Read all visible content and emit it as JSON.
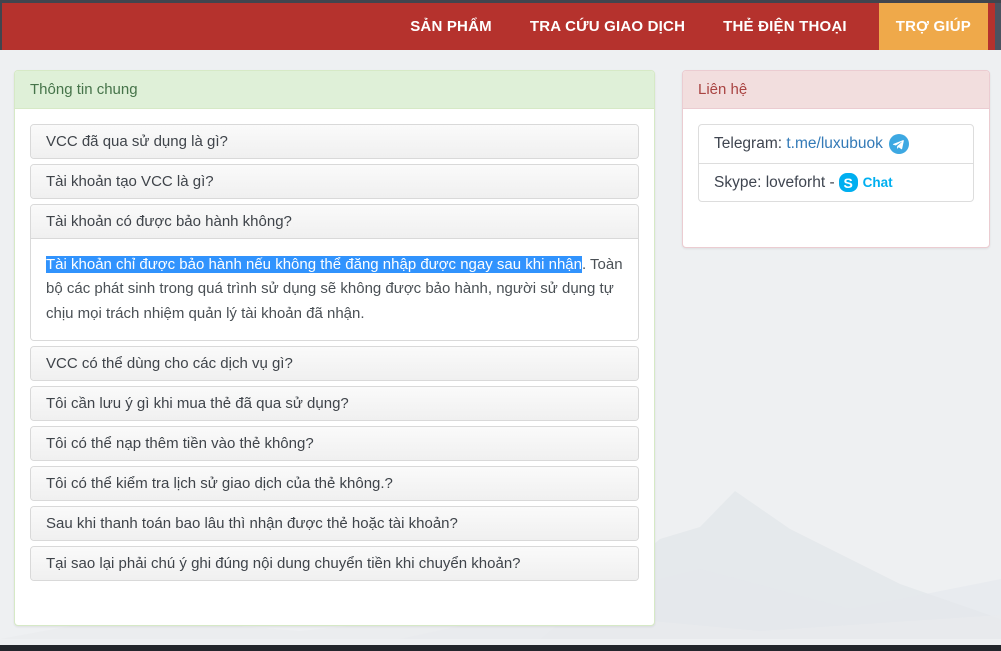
{
  "navbar": {
    "items": [
      {
        "label": "SẢN PHẨM",
        "active": false
      },
      {
        "label": "TRA CỨU GIAO DỊCH",
        "active": false
      },
      {
        "label": "THẺ ĐIỆN THOẠI",
        "active": false
      },
      {
        "label": "TRỢ GIÚP",
        "active": true
      }
    ]
  },
  "faq": {
    "title": "Thông tin chung",
    "items": [
      {
        "question": "VCC đã qua sử dụng là gì?"
      },
      {
        "question": "Tài khoản tạo VCC là gì?"
      },
      {
        "question": "Tài khoản có được bảo hành không?",
        "expanded": true,
        "answer_selected": "Tài khoản chỉ được bảo hành nếu không thể đăng nhập được ngay sau khi nhận",
        "answer_rest": ". Toàn bộ các phát sinh trong quá trình sử dụng sẽ không được bảo hành, người sử dụng tự chịu mọi trách nhiệm quản lý tài khoản đã nhận."
      },
      {
        "question": "VCC có thể dùng cho các dịch vụ gì?"
      },
      {
        "question": "Tôi cần lưu ý gì khi mua thẻ đã qua sử dụng?"
      },
      {
        "question": "Tôi có thể nạp thêm tiền vào thẻ không?"
      },
      {
        "question": "Tôi có thể kiểm tra lịch sử giao dịch của thẻ không.?"
      },
      {
        "question": "Sau khi thanh toán bao lâu thì nhận được thẻ hoặc tài khoản?"
      },
      {
        "question": "Tại sao lại phải chú ý ghi đúng nội dung chuyển tiền khi chuyển khoản?"
      }
    ]
  },
  "contact": {
    "title": "Liên hệ",
    "telegram_label": "Telegram:",
    "telegram_link": "t.me/luxubuok",
    "telegram_icon": "telegram-icon",
    "skype_label": "Skype: loveforht -",
    "skype_icon": "skype-icon",
    "skype_icon_letter": "S",
    "chat_label": "Chat"
  },
  "colors": {
    "navbar_red": "#b5322d",
    "active_orange": "#efa94a",
    "success_header_bg": "#dff0d8",
    "success_header_text": "#46744a",
    "danger_header_bg": "#f2dede",
    "danger_header_text": "#a94442",
    "selection_blue": "#3193fd",
    "link_blue": "#337ab7",
    "skype_blue": "#00aff0",
    "telegram_blue": "#3da8e2"
  }
}
